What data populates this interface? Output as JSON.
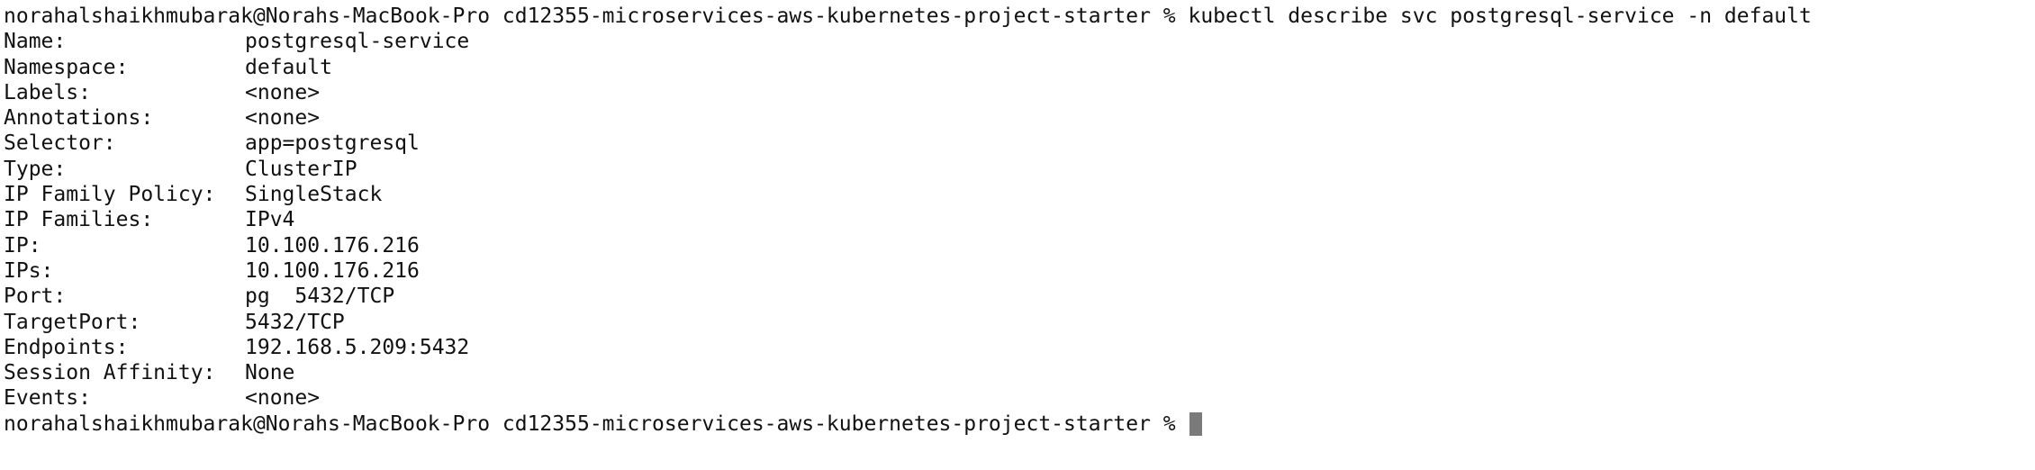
{
  "terminal": {
    "command_line": "norahalshaikhmubarak@Norahs-MacBook-Pro cd12355-microservices-aws-kubernetes-project-starter % kubectl describe svc postgresql-service -n default",
    "fields": [
      {
        "key": "Name:",
        "value": "postgresql-service"
      },
      {
        "key": "Namespace:",
        "value": "default"
      },
      {
        "key": "Labels:",
        "value": "<none>"
      },
      {
        "key": "Annotations:",
        "value": "<none>"
      },
      {
        "key": "Selector:",
        "value": "app=postgresql"
      },
      {
        "key": "Type:",
        "value": "ClusterIP"
      },
      {
        "key": "IP Family Policy:",
        "value": "SingleStack"
      },
      {
        "key": "IP Families:",
        "value": "IPv4"
      },
      {
        "key": "IP:",
        "value": "10.100.176.216"
      },
      {
        "key": "IPs:",
        "value": "10.100.176.216"
      },
      {
        "key": "Port:",
        "value": "pg  5432/TCP"
      },
      {
        "key": "TargetPort:",
        "value": "5432/TCP"
      },
      {
        "key": "Endpoints:",
        "value": "192.168.5.209:5432"
      },
      {
        "key": "Session Affinity:",
        "value": "None"
      },
      {
        "key": "Events:",
        "value": "<none>"
      }
    ],
    "prompt_line": "norahalshaikhmubarak@Norahs-MacBook-Pro cd12355-microservices-aws-kubernetes-project-starter % "
  }
}
